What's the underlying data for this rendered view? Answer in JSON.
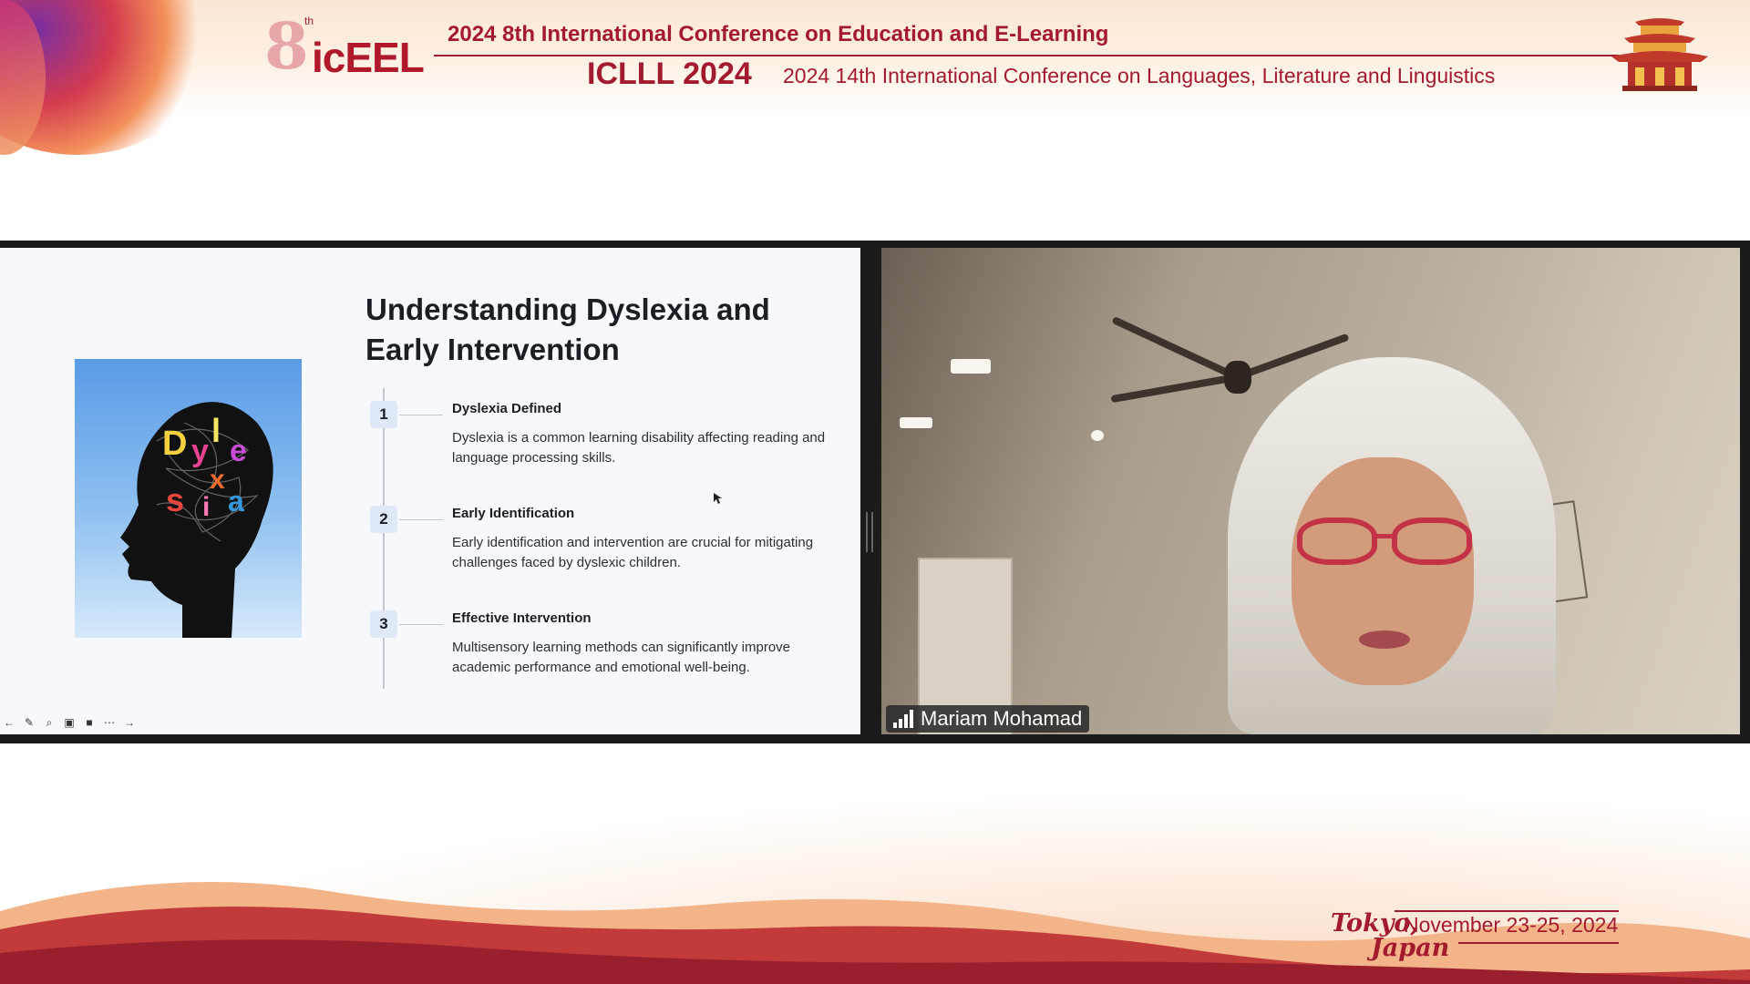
{
  "header": {
    "logo_text": "icEEL",
    "logo_number": "8",
    "logo_suffix": "th",
    "conference_primary": "2024 8th International Conference on Education and E-Learning",
    "conference_secondary_short": "ICLLL 2024",
    "conference_secondary_long": "2024 14th International Conference on Languages, Literature and Linguistics",
    "brand_color": "#a3192d"
  },
  "slide": {
    "title": "Understanding Dyslexia and Early Intervention",
    "image_letters": [
      "D",
      "y",
      "l",
      "e",
      "x",
      "s",
      "i",
      "a"
    ],
    "steps": [
      {
        "number": "1",
        "title": "Dyslexia Defined",
        "body": "Dyslexia is a common learning disability affecting reading and language processing skills."
      },
      {
        "number": "2",
        "title": "Early Identification",
        "body": "Early identification and intervention are crucial for mitigating challenges faced by dyslexic children."
      },
      {
        "number": "3",
        "title": "Effective Intervention",
        "body": "Multisensory learning methods can significantly improve academic performance and emotional well-being."
      }
    ],
    "toolbar_icons": [
      "previous-slide-icon",
      "pen-icon",
      "zoom-icon",
      "captions-icon",
      "video-icon",
      "more-icon",
      "next-slide-icon"
    ]
  },
  "participant": {
    "name": "Mariam Mohamad",
    "signal_icon": "signal-bars-icon"
  },
  "footer": {
    "city": "Tokyo,",
    "country": "Japan",
    "dates": "November 23-25, 2024"
  }
}
